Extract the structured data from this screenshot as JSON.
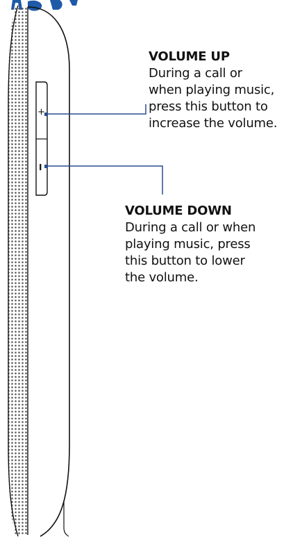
{
  "colors": {
    "header_fragment": "#1e5aa8",
    "leader_line": "#2a4d8c",
    "outline": "#111111",
    "speaker_dots": "#555555"
  },
  "labels": {
    "plus_mark": "+",
    "minus_mark": "I"
  },
  "callouts": {
    "volume_up": {
      "title": "VOLUME UP",
      "description": "During a call or\nwhen playing music,\npress this button to\nincrease the volume."
    },
    "volume_down": {
      "title": "VOLUME DOWN",
      "description": "During a call or when\nplaying music, press\nthis button to lower\nthe volume."
    }
  }
}
